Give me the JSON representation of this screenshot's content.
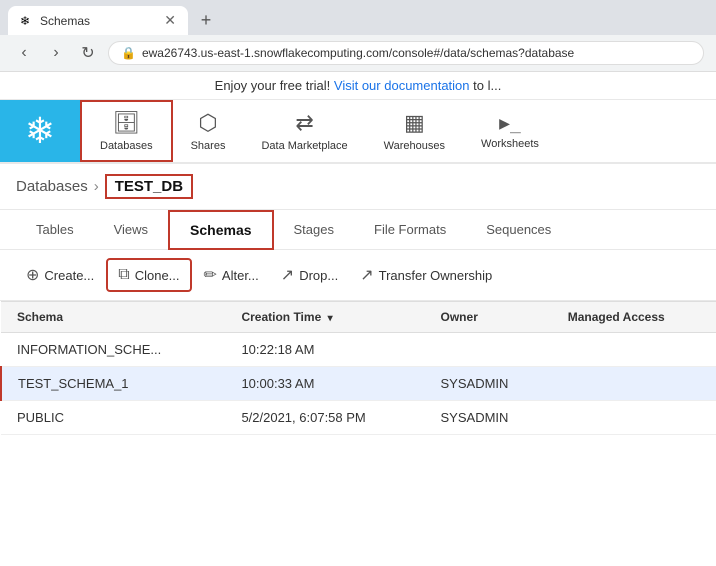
{
  "browser": {
    "tab_title": "Schemas",
    "tab_favicon": "❄",
    "url": "ewa26743.us-east-1.snowflakecomputing.com/console#/data/schemas?database",
    "new_tab_icon": "+"
  },
  "banner": {
    "text": "Enjoy your free trial!",
    "link_text": "Visit our documentation",
    "suffix": " to l..."
  },
  "header": {
    "nav_items": [
      {
        "id": "databases",
        "label": "Databases",
        "icon": "🗄",
        "active": true
      },
      {
        "id": "shares",
        "label": "Shares",
        "icon": "⬆",
        "active": false
      },
      {
        "id": "data-marketplace",
        "label": "Data Marketplace",
        "icon": "⇄",
        "active": false
      },
      {
        "id": "warehouses",
        "label": "Warehouses",
        "icon": "▦",
        "active": false
      },
      {
        "id": "worksheets",
        "label": "Worksheets",
        "icon": ">_",
        "active": false
      }
    ]
  },
  "breadcrumb": {
    "root": "Databases",
    "separator": "›",
    "current": "TEST_DB"
  },
  "tabs": {
    "items": [
      {
        "id": "tables",
        "label": "Tables",
        "active": false
      },
      {
        "id": "views",
        "label": "Views",
        "active": false
      },
      {
        "id": "schemas",
        "label": "Schemas",
        "active": true
      },
      {
        "id": "stages",
        "label": "Stages",
        "active": false
      },
      {
        "id": "file-formats",
        "label": "File Formats",
        "active": false
      },
      {
        "id": "sequences",
        "label": "Sequences",
        "active": false
      }
    ]
  },
  "toolbar": {
    "buttons": [
      {
        "id": "create",
        "label": "Create...",
        "icon": "⊕"
      },
      {
        "id": "clone",
        "label": "Clone...",
        "icon": "⧉",
        "highlighted": true
      },
      {
        "id": "alter",
        "label": "Alter...",
        "icon": "✏"
      },
      {
        "id": "drop",
        "label": "Drop...",
        "icon": "↗"
      },
      {
        "id": "transfer-ownership",
        "label": "Transfer Ownership",
        "icon": "↗"
      }
    ]
  },
  "table": {
    "columns": [
      {
        "id": "schema",
        "label": "Schema"
      },
      {
        "id": "creation-time",
        "label": "Creation Time",
        "sort": "▾"
      },
      {
        "id": "owner",
        "label": "Owner"
      },
      {
        "id": "managed-access",
        "label": "Managed Access"
      }
    ],
    "rows": [
      {
        "schema": "INFORMATION_SCHE...",
        "creation_time": "10:22:18 AM",
        "owner": "",
        "managed_access": "",
        "selected": false
      },
      {
        "schema": "TEST_SCHEMA_1",
        "creation_time": "10:00:33 AM",
        "owner": "SYSADMIN",
        "managed_access": "",
        "selected": true
      },
      {
        "schema": "PUBLIC",
        "creation_time": "5/2/2021, 6:07:58 PM",
        "owner": "SYSADMIN",
        "managed_access": "",
        "selected": false
      }
    ]
  },
  "close_icon": "✕"
}
